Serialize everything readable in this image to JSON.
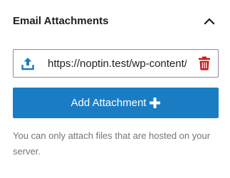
{
  "section": {
    "title": "Email Attachments",
    "collapse_icon": "chevron-up-icon"
  },
  "attachment": {
    "url": "https://noptin.test/wp-content/uploads/",
    "upload_icon": "upload-icon",
    "delete_icon": "trash-icon",
    "delete_color": "#cc1818"
  },
  "add_button": {
    "label": "Add Attachment",
    "icon": "plus-icon",
    "color": "#1a7dc4"
  },
  "help_text": "You can only attach files that are hosted on your server."
}
